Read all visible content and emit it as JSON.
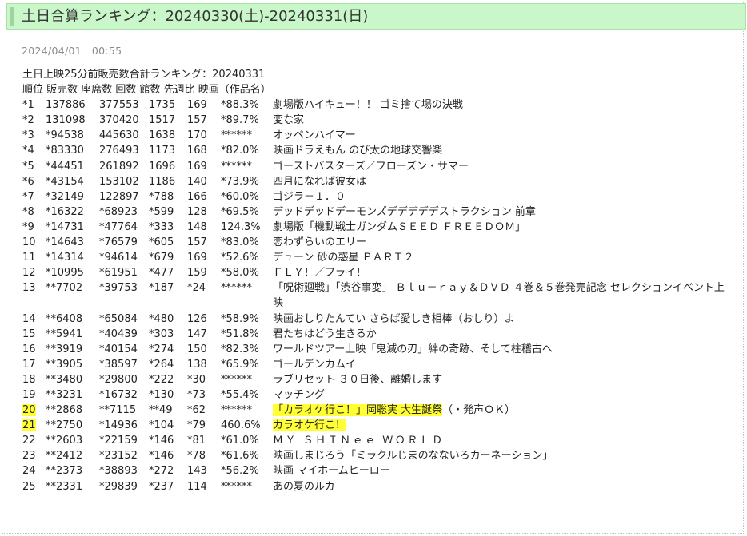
{
  "page": {
    "title": "土日合算ランキング：20240330(土)-20240331(日)",
    "date": "2024/04/01   00:55"
  },
  "content": {
    "heading": "土日上映25分前販売数合計ランキング：20240331",
    "columns": "順位 販売数 座席数 回数 館数 先週比 映画（作品名）",
    "rows": [
      {
        "rank": "*1",
        "sales": "137886",
        "seats": "377553",
        "count": "1735",
        "halls": "169",
        "ratio": "*88.3%",
        "title": "劇場版ハイキュー！！ ゴミ捨て場の決戦"
      },
      {
        "rank": "*2",
        "sales": "131098",
        "seats": "370420",
        "count": "1517",
        "halls": "157",
        "ratio": "*89.7%",
        "title": "変な家"
      },
      {
        "rank": "*3",
        "sales": "*94538",
        "seats": "445630",
        "count": "1638",
        "halls": "170",
        "ratio": "******",
        "title": "オッペンハイマー"
      },
      {
        "rank": "*4",
        "sales": "*83330",
        "seats": "276493",
        "count": "1173",
        "halls": "168",
        "ratio": "*82.0%",
        "title": "映画ドラえもん のび太の地球交響楽"
      },
      {
        "rank": "*5",
        "sales": "*44451",
        "seats": "261892",
        "count": "1696",
        "halls": "169",
        "ratio": "******",
        "title": "ゴーストバスターズ／フローズン・サマー"
      },
      {
        "rank": "*6",
        "sales": "*43154",
        "seats": "153102",
        "count": "1186",
        "halls": "140",
        "ratio": "*73.9%",
        "title": "四月になれば彼女は"
      },
      {
        "rank": "*7",
        "sales": "*32149",
        "seats": "122897",
        "count": "*788",
        "halls": "166",
        "ratio": "*60.0%",
        "title": "ゴジラ－１．０"
      },
      {
        "rank": "*8",
        "sales": "*16322",
        "seats": "*68923",
        "count": "*599",
        "halls": "128",
        "ratio": "*69.5%",
        "title": "デッドデッドデーモンズデデデデデストラクション 前章"
      },
      {
        "rank": "*9",
        "sales": "*14731",
        "seats": "*47764",
        "count": "*333",
        "halls": "148",
        "ratio": "124.3%",
        "title": "劇場版「機動戦士ガンダムＳＥＥＤ ＦＲＥＥＤＯＭ」"
      },
      {
        "rank": "10",
        "sales": "*14643",
        "seats": "*76579",
        "count": "*605",
        "halls": "157",
        "ratio": "*83.0%",
        "title": "恋わずらいのエリー"
      },
      {
        "rank": "11",
        "sales": "*14314",
        "seats": "*94614",
        "count": "*679",
        "halls": "169",
        "ratio": "*52.6%",
        "title": "デューン 砂の惑星 ＰＡＲＴ２"
      },
      {
        "rank": "12",
        "sales": "*10995",
        "seats": "*61951",
        "count": "*477",
        "halls": "159",
        "ratio": "*58.0%",
        "title": "ＦＬＹ！／フライ！"
      },
      {
        "rank": "13",
        "sales": "**7702",
        "seats": "*39753",
        "count": "*187",
        "halls": "*24",
        "ratio": "******",
        "title": "「呪術廻戦」「渋谷事変」 Ｂｌｕ－ｒａｙ＆ＤＶＤ ４巻＆５巻発売記念 セレクションイベント上映"
      },
      {
        "rank": "14",
        "sales": "**6408",
        "seats": "*65084",
        "count": "*480",
        "halls": "126",
        "ratio": "*58.9%",
        "title": "映画おしりたんてい さらば愛しき相棒（おしり）よ"
      },
      {
        "rank": "15",
        "sales": "**5941",
        "seats": "*40439",
        "count": "*303",
        "halls": "147",
        "ratio": "*51.8%",
        "title": "君たちはどう生きるか"
      },
      {
        "rank": "16",
        "sales": "**3919",
        "seats": "*40154",
        "count": "*274",
        "halls": "150",
        "ratio": "*82.3%",
        "title": "ワールドツアー上映「鬼滅の刃」絆の奇跡、そして柱稽古へ"
      },
      {
        "rank": "17",
        "sales": "**3905",
        "seats": "*38597",
        "count": "*264",
        "halls": "138",
        "ratio": "*65.9%",
        "title": "ゴールデンカムイ"
      },
      {
        "rank": "18",
        "sales": "**3480",
        "seats": "*29800",
        "count": "*222",
        "halls": "*30",
        "ratio": "******",
        "title": "ラブリセット ３０日後、離婚します"
      },
      {
        "rank": "19",
        "sales": "**3231",
        "seats": "*16732",
        "count": "*130",
        "halls": "*73",
        "ratio": "*55.4%",
        "title": "マッチング"
      },
      {
        "rank": "20",
        "sales": "**2868",
        "seats": "**7115",
        "count": "**49",
        "halls": "*62",
        "ratio": "******",
        "title": "「カラオケ行こ！」岡聡実 大生誕祭",
        "title_rest": "（・発声ＯＫ）",
        "highlight": true
      },
      {
        "rank": "21",
        "sales": "**2750",
        "seats": "*14936",
        "count": "*104",
        "halls": "*79",
        "ratio": "460.6%",
        "title": "カラオケ行こ！",
        "highlight": true
      },
      {
        "rank": "22",
        "sales": "**2603",
        "seats": "*22159",
        "count": "*146",
        "halls": "*81",
        "ratio": "*61.0%",
        "title": "ＭＹ ＳＨＩＮｅｅ ＷＯＲＬＤ"
      },
      {
        "rank": "23",
        "sales": "**2412",
        "seats": "*23152",
        "count": "*146",
        "halls": "*78",
        "ratio": "*61.6%",
        "title": "映画しまじろう「ミラクルじまのなないろカーネーション」"
      },
      {
        "rank": "24",
        "sales": "**2373",
        "seats": "*38893",
        "count": "*272",
        "halls": "143",
        "ratio": "*56.2%",
        "title": "映画 マイホームヒーロー"
      },
      {
        "rank": "25",
        "sales": "**2331",
        "seats": "*29839",
        "count": "*237",
        "halls": "114",
        "ratio": "******",
        "title": "あの夏のルカ"
      }
    ]
  },
  "colors": {
    "title_bar_bg": "#c9f7c9",
    "highlight": "#ffff33",
    "date_text": "#8a8a8a"
  }
}
